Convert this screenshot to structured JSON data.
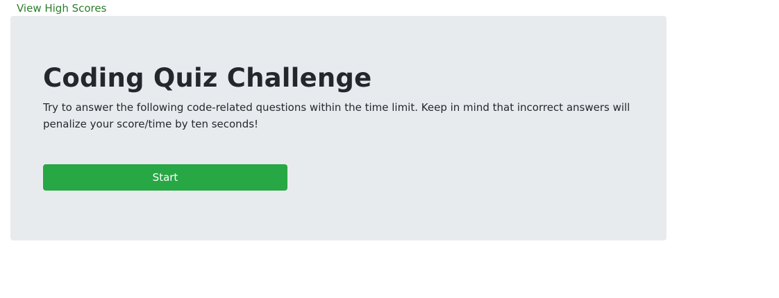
{
  "header": {
    "highscores_label": "View High Scores"
  },
  "quiz": {
    "title": "Coding Quiz Challenge",
    "description": "Try to answer the following code-related questions within the time limit. Keep in mind that incorrect answers will penalize your score/time by ten seconds!",
    "start_label": "Start"
  },
  "colors": {
    "link": "#2a7d2a",
    "panel_bg": "#e8ebee",
    "button": "#28a745",
    "text": "#23282d"
  }
}
